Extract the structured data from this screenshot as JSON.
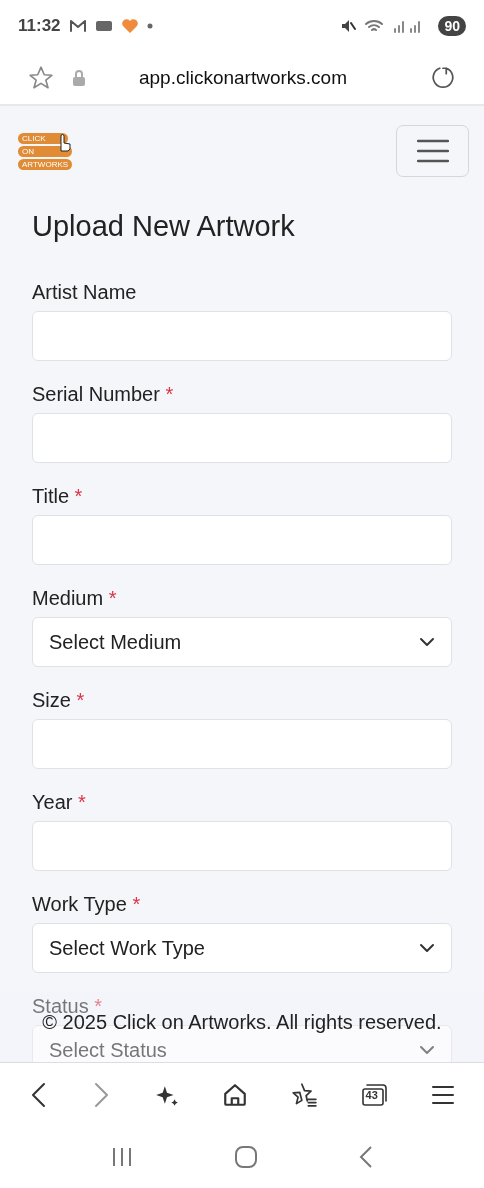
{
  "status_bar": {
    "time": "11:32",
    "battery": "90"
  },
  "browser": {
    "url": "app.clickonartworks.com"
  },
  "navbar": {
    "logo_lines": [
      "CLICK",
      "ON",
      "ARTWORKS"
    ]
  },
  "form": {
    "title": "Upload New Artwork",
    "required_mark": "*",
    "fields": [
      {
        "kind": "text",
        "label": "Artist Name",
        "required": false
      },
      {
        "kind": "text",
        "label": "Serial Number",
        "required": true
      },
      {
        "kind": "text",
        "label": "Title",
        "required": true
      },
      {
        "kind": "select",
        "label": "Medium",
        "required": true,
        "value": "Select Medium"
      },
      {
        "kind": "text",
        "label": "Size",
        "required": true
      },
      {
        "kind": "text",
        "label": "Year",
        "required": true
      },
      {
        "kind": "select",
        "label": "Work Type",
        "required": true,
        "value": "Select Work Type"
      },
      {
        "kind": "select",
        "label": "Status",
        "required": true,
        "value": "Select Status"
      }
    ]
  },
  "footer": {
    "text": "© 2025 Click on Artworks. All rights reserved."
  },
  "bottom_nav": {
    "tabs_count": "43"
  }
}
